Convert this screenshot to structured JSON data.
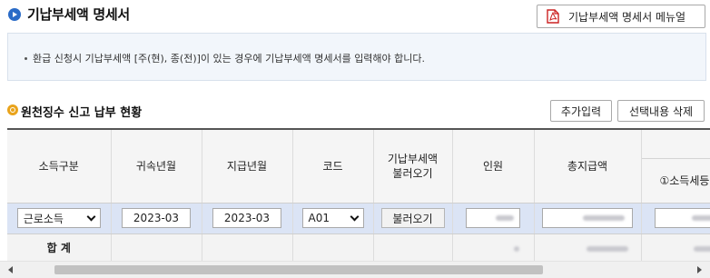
{
  "header": {
    "title": "기납부세액 명세서",
    "manual_button": "기납부세액 명세서 메뉴얼",
    "manual_icon": "pdf-icon"
  },
  "notice": {
    "text": "환급 신청시 기납부세액 [주(현), 종(전)]이 있는 경우에 기납부세액 명세서를 입력해야 합니다."
  },
  "section": {
    "title": "원천징수 신고 납부 현황",
    "add_button": "추가입력",
    "delete_button": "선택내용 삭제"
  },
  "table": {
    "columns": {
      "income_type": "소득구분",
      "belong_ym": "귀속년월",
      "pay_ym": "지급년월",
      "code": "코드",
      "load_prepaid": "기납부세액 불러오기",
      "persons": "인원",
      "total_pay": "총지급액",
      "income_tax": "①소득세등"
    },
    "row": {
      "income_type": "근로소득",
      "belong_ym": "2023-03",
      "pay_ym": "2023-03",
      "code": "A01",
      "load_button": "불러오기"
    },
    "sum_label": "합 계"
  },
  "colors": {
    "title_bullet": "#2a6bc7",
    "section_bullet": "#e9a31b",
    "selected_row": "#dbe4f5",
    "notice_bg": "#f2f6fb"
  }
}
